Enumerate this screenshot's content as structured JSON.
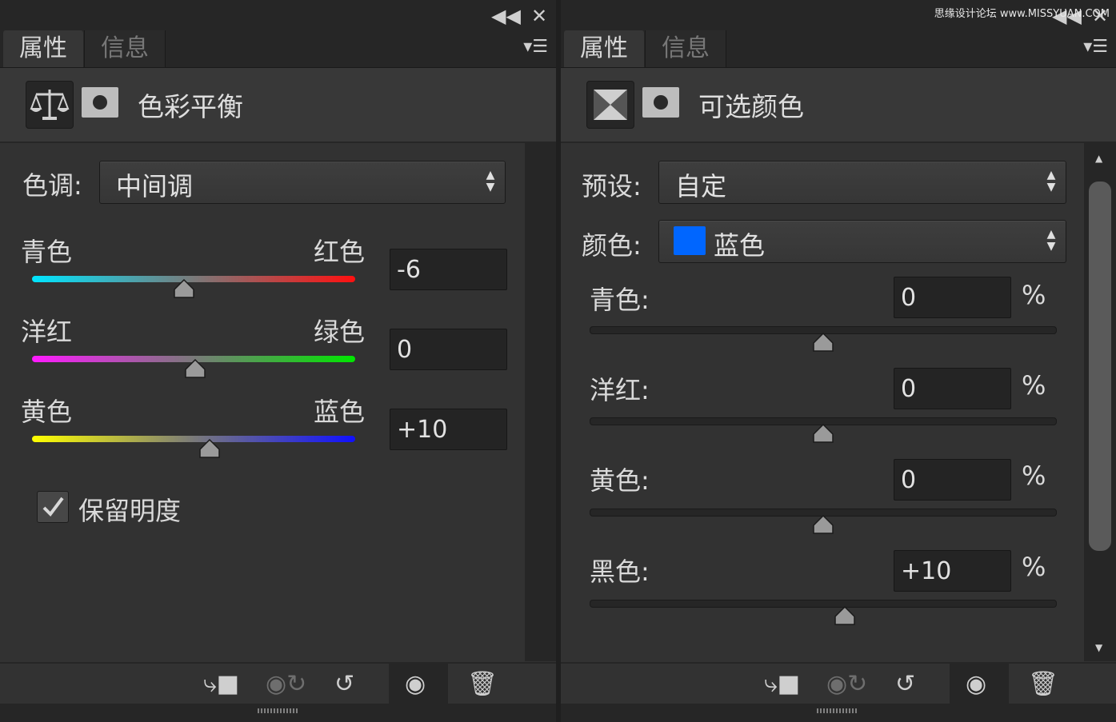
{
  "left_panel": {
    "tabs": [
      "属性",
      "信息"
    ],
    "header_title": "色彩平衡",
    "tone_label": "色调:",
    "tone_value": "中间调",
    "sliders": [
      {
        "left": "青色",
        "right": "红色",
        "value": "-6",
        "level": -6
      },
      {
        "left": "洋红",
        "right": "绿色",
        "value": "0",
        "level": 0
      },
      {
        "left": "黄色",
        "right": "蓝色",
        "value": "+10",
        "level": 10
      }
    ],
    "preserve_luminosity": {
      "label": "保留明度",
      "checked": true
    }
  },
  "right_panel": {
    "tabs": [
      "属性",
      "信息"
    ],
    "header_title": "可选颜色",
    "preset_label": "预设:",
    "preset_value": "自定",
    "color_label": "颜色:",
    "color_value": "蓝色",
    "color_swatch": "#0066ff",
    "percent_sign": "%",
    "rows": [
      {
        "label": "青色:",
        "value": "0",
        "level": 0
      },
      {
        "label": "洋红:",
        "value": "0",
        "level": 0
      },
      {
        "label": "黄色:",
        "value": "0",
        "level": 0
      },
      {
        "label": "黑色:",
        "value": "+10",
        "level": 10
      }
    ]
  },
  "watermark": "思缘设计论坛 www.MISSYUAN.COM"
}
